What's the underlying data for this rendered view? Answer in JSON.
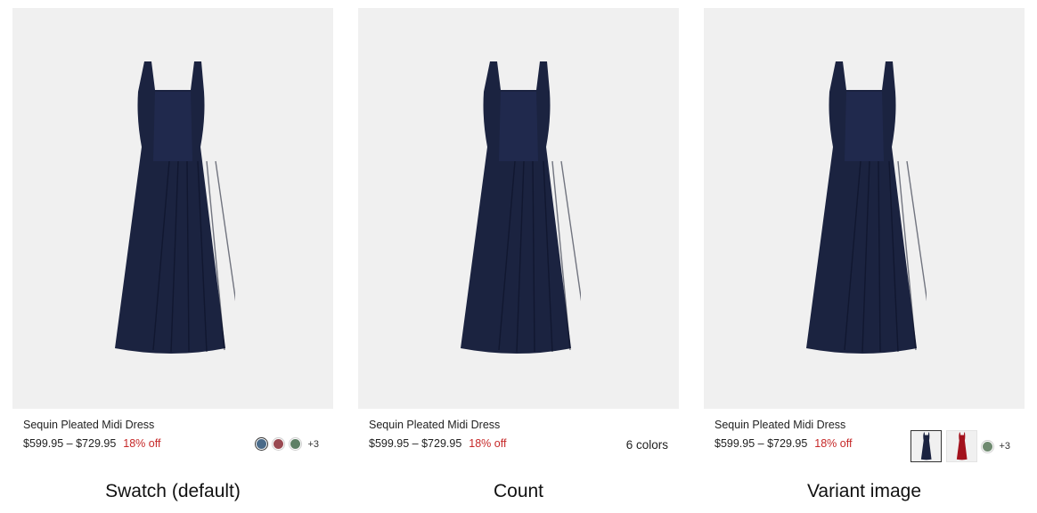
{
  "cards": [
    {
      "title": "Sequin Pleated Midi Dress",
      "price": "$599.95 – $729.95",
      "discount": "18% off",
      "swatches": [
        {
          "color": "#4a6b8a",
          "selected": true
        },
        {
          "color": "#9a4a52"
        },
        {
          "color": "#5e8066"
        }
      ],
      "more": "+3",
      "caption": "Swatch (default)"
    },
    {
      "title": "Sequin Pleated Midi Dress",
      "price": "$599.95 – $729.95",
      "discount": "18% off",
      "count": "6 colors",
      "caption": "Count"
    },
    {
      "title": "Sequin Pleated Midi Dress",
      "price": "$599.95 – $729.95",
      "discount": "18% off",
      "variant_images": [
        {
          "color": "navy",
          "selected": true
        },
        {
          "color": "red"
        }
      ],
      "swatches": [
        {
          "color": "#6f8a70"
        }
      ],
      "more": "+3",
      "caption": "Variant image"
    }
  ],
  "colors": {
    "navy_dress": "#1b2340",
    "red_dress": "#a3121d",
    "discount": "#c62828",
    "image_bg": "#f0f0f0"
  }
}
